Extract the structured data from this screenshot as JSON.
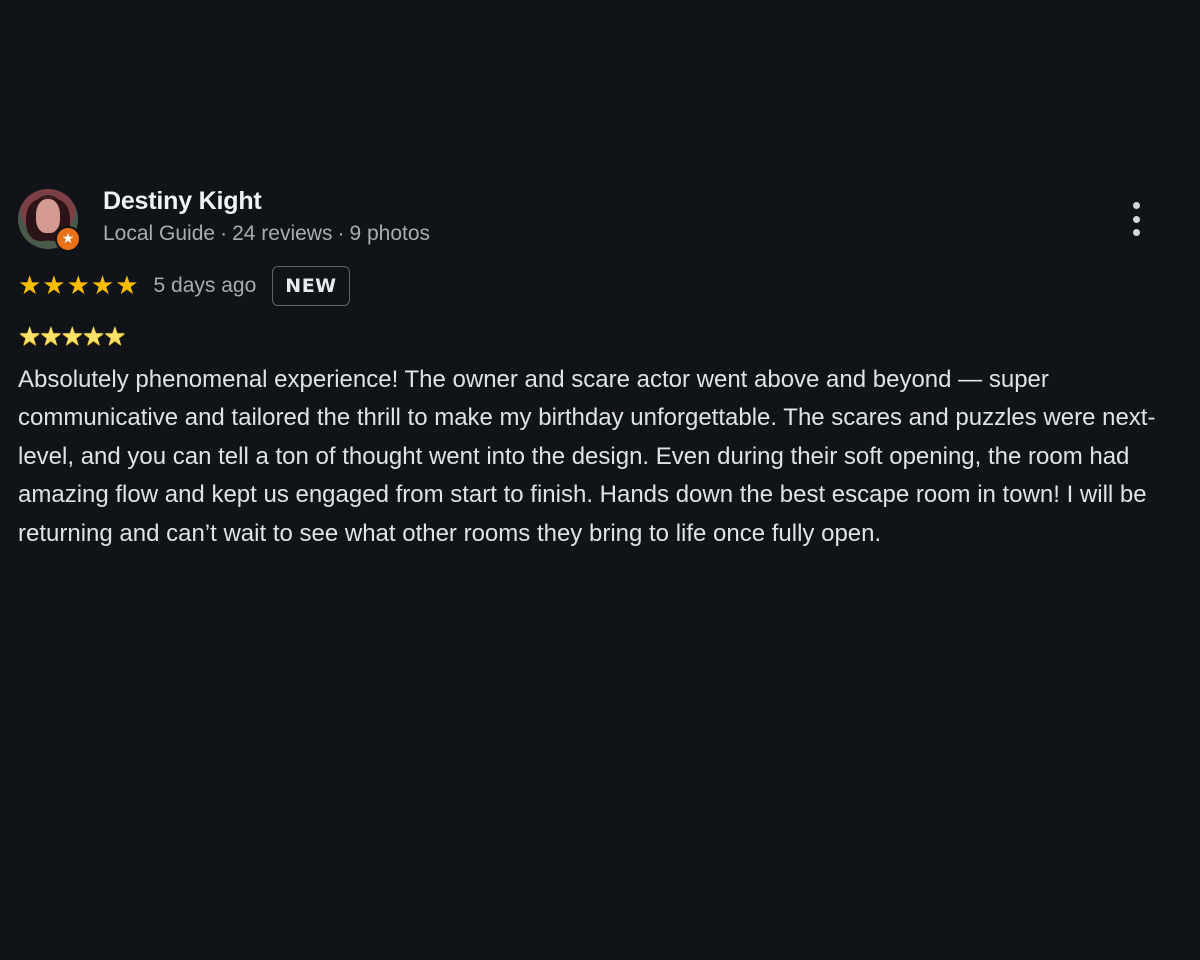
{
  "reviewer": {
    "name": "Destiny Kight",
    "role": "Local Guide",
    "reviews": "24 reviews",
    "photos": "9 photos",
    "separator": "·"
  },
  "rating": {
    "stars": "★★★★★",
    "value": 5,
    "max": 5,
    "time_ago": "5 days ago",
    "badge": "NEW",
    "star_color": "#fbbc04"
  },
  "review": {
    "emoji_stars": "★★★★★",
    "text": "Absolutely phenomenal experience! The owner and scare actor went above and beyond — super communicative and tailored the thrill to make my birthday unforgettable. The scares and puzzles were next-level, and you can tell a ton of thought went into the design. Even during their soft opening, the room had amazing flow and kept us engaged from start to finish. Hands down the best escape room in town! I will be returning and can’t wait to see what other rooms they bring to life once fully open."
  },
  "icons": {
    "avatar_badge": "local-guide-star-icon",
    "menu": "more-vert-icon"
  },
  "colors": {
    "background": "#101317",
    "badge_orange": "#e8711a"
  }
}
